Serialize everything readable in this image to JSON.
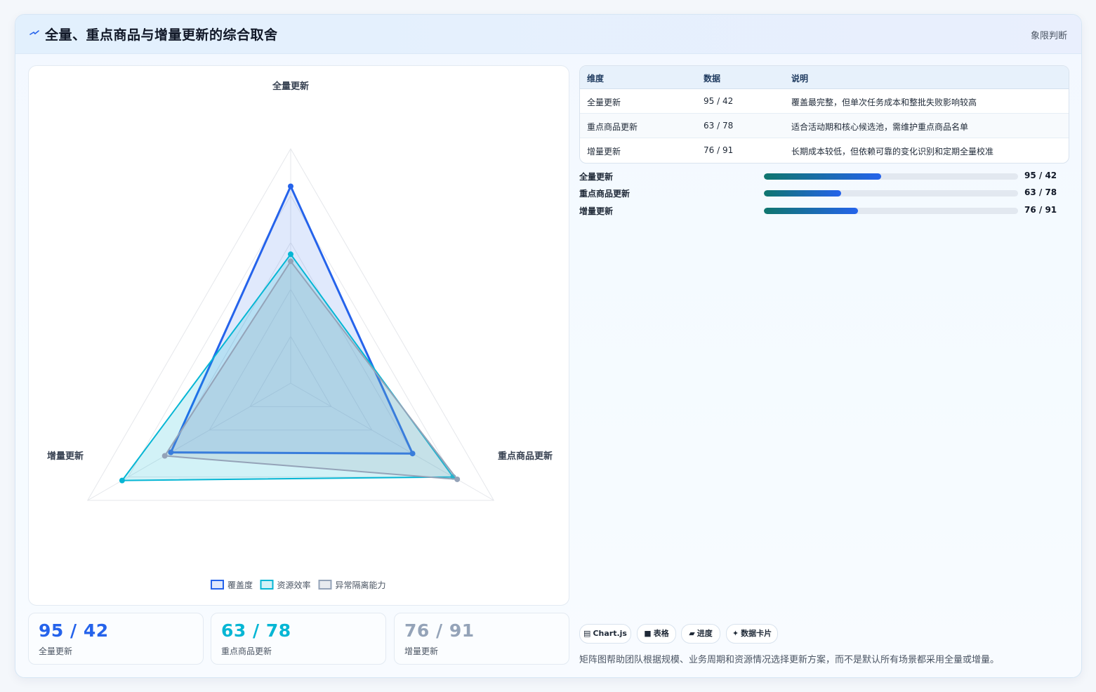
{
  "header": {
    "title": "全量、重点商品与增量更新的综合取舍",
    "tag": "象限判断",
    "icon": "trend-line-icon"
  },
  "chart_data": {
    "type": "radar",
    "axes": [
      "全量更新",
      "重点商品更新",
      "增量更新"
    ],
    "range": [
      0,
      100
    ],
    "grid_levels": 5,
    "legend_position": "bottom",
    "series": [
      {
        "name": "覆盖度",
        "values": [
          84,
          60,
          59
        ],
        "color": "#2563eb",
        "fill": "rgba(37,99,235,0.14)"
      },
      {
        "name": "资源效率",
        "values": [
          55,
          80,
          83
        ],
        "color": "#06b6d4",
        "fill": "rgba(6,182,212,0.18)"
      },
      {
        "name": "异常隔离能力",
        "values": [
          52,
          82,
          62
        ],
        "color": "#94a3b8",
        "fill": "rgba(148,163,184,0.22)"
      }
    ]
  },
  "stats": [
    {
      "value": "95 / 42",
      "label": "全量更新",
      "color": "#2563eb"
    },
    {
      "value": "63 / 78",
      "label": "重点商品更新",
      "color": "#06b6d4"
    },
    {
      "value": "76 / 91",
      "label": "增量更新",
      "color": "#94a3b8"
    }
  ],
  "table": {
    "headers": [
      "维度",
      "数据",
      "说明"
    ],
    "rows": [
      {
        "dim": "全量更新",
        "data": "95 / 42",
        "desc": "覆盖最完整，但单次任务成本和整批失败影响较高"
      },
      {
        "dim": "重点商品更新",
        "data": "63 / 78",
        "desc": "适合活动期和核心候选池，需维护重点商品名单"
      },
      {
        "dim": "增量更新",
        "data": "76 / 91",
        "desc": "长期成本较低，但依赖可靠的变化识别和定期全量校准"
      }
    ]
  },
  "progress": [
    {
      "label": "全量更新",
      "value": "95 / 42",
      "fraction": 0.46
    },
    {
      "label": "重点商品更新",
      "value": "63 / 78",
      "fraction": 0.305
    },
    {
      "label": "增量更新",
      "value": "76 / 91",
      "fraction": 0.37
    }
  ],
  "chips": [
    {
      "icon": "chart-icon",
      "glyph": "▤",
      "label": "Chart.js"
    },
    {
      "icon": "table-icon",
      "glyph": "■",
      "label": "表格"
    },
    {
      "icon": "progress-icon",
      "glyph": "▰",
      "label": "进度"
    },
    {
      "icon": "sparkle-icon",
      "glyph": "✦",
      "label": "数据卡片"
    }
  ],
  "footnote": "矩阵图帮助团队根据规模、业务周期和资源情况选择更新方案，而不是默认所有场景都采用全量或增量。"
}
